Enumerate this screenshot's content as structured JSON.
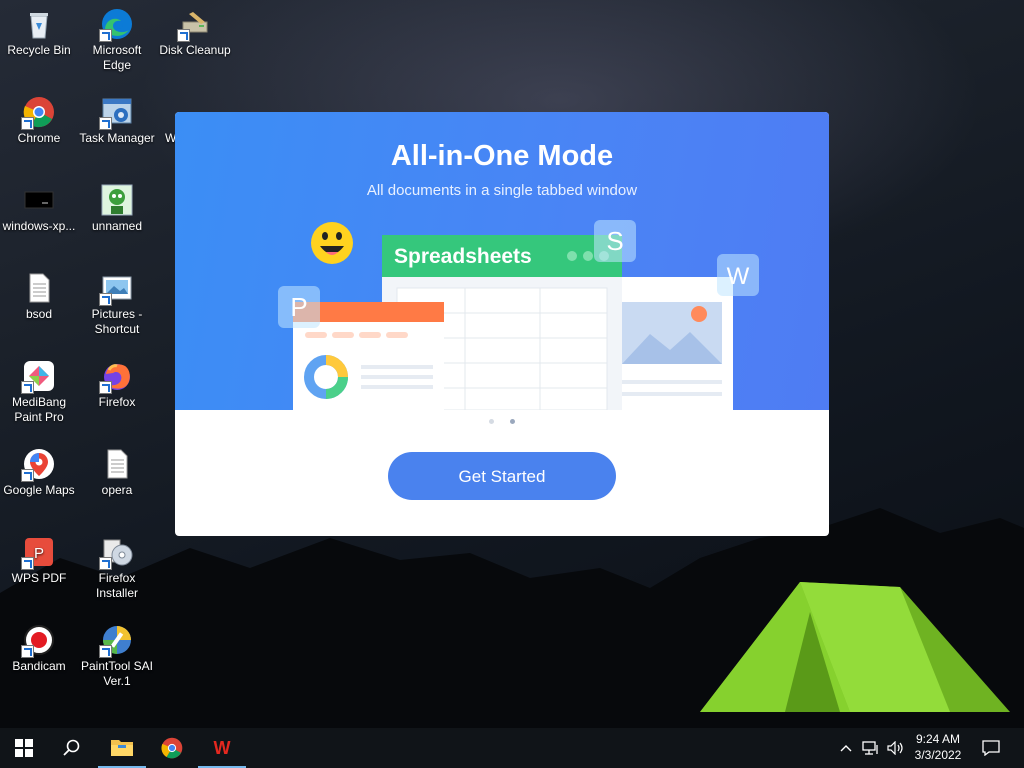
{
  "desktop": {
    "icons": [
      {
        "label": "Recycle Bin",
        "icon": "recycle-bin-icon"
      },
      {
        "label": "Microsoft Edge",
        "icon": "edge-icon"
      },
      {
        "label": "Disk Cleanup",
        "icon": "disk-cleanup-icon"
      },
      {
        "label": "Chrome",
        "icon": "chrome-icon"
      },
      {
        "label": "Task Manager",
        "icon": "task-manager-icon"
      },
      {
        "label": "W",
        "icon": "wps-office-icon"
      },
      {
        "label": "windows-xp...",
        "icon": "windows-xp-icon"
      },
      {
        "label": "unnamed",
        "icon": "unnamed-image-icon"
      },
      {
        "label": "bsod",
        "icon": "text-file-icon"
      },
      {
        "label": "Pictures - Shortcut",
        "icon": "pictures-folder-icon"
      },
      {
        "label": "MediBang Paint Pro",
        "icon": "medibang-icon"
      },
      {
        "label": "Firefox",
        "icon": "firefox-icon"
      },
      {
        "label": "Google Maps",
        "icon": "google-maps-icon"
      },
      {
        "label": "opera",
        "icon": "text-file-icon"
      },
      {
        "label": "WPS PDF",
        "icon": "wps-pdf-icon"
      },
      {
        "label": "Firefox Installer",
        "icon": "firefox-installer-icon"
      },
      {
        "label": "Bandicam",
        "icon": "bandicam-icon"
      },
      {
        "label": "PaintTool SAI Ver.1",
        "icon": "painttool-sai-icon"
      }
    ]
  },
  "dialog": {
    "title": "All-in-One Mode",
    "subtitle": "All documents in a single tabbed window",
    "illustration": {
      "card_label": "Spreadsheets",
      "badges": [
        "S",
        "W",
        "P"
      ]
    },
    "pager": {
      "count": 2,
      "active": 2
    },
    "button_label": "Get Started",
    "colors": {
      "banner": "#4a86f4",
      "button": "#4a82ee",
      "spreadsheet_green": "#34c77b",
      "presentation_orange": "#ff7a45"
    }
  },
  "taskbar": {
    "items": [
      "start-icon",
      "search-icon",
      "file-explorer-icon",
      "chrome-icon",
      "wps-office-icon"
    ],
    "tray": [
      "chevron-up-icon",
      "network-icon",
      "volume-icon"
    ],
    "time": "9:24 AM",
    "date": "3/3/2022",
    "notification": "notification-icon"
  }
}
